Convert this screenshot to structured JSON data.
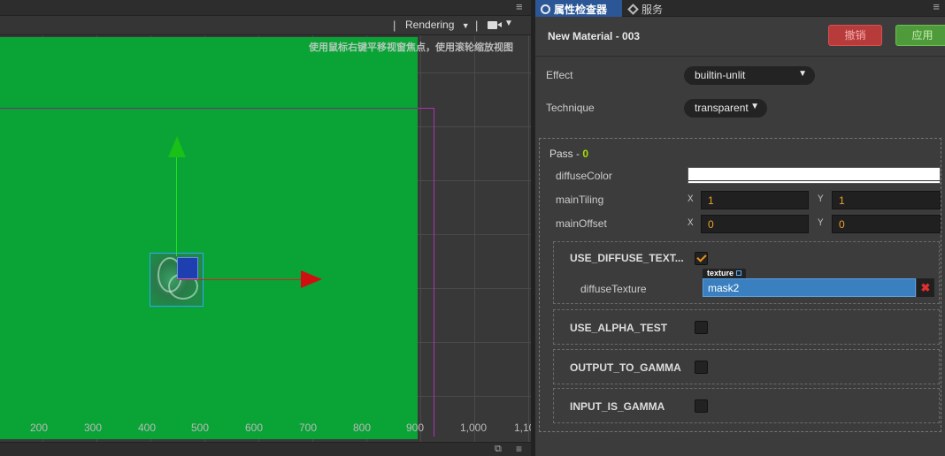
{
  "scene": {
    "rendering_label": "Rendering",
    "rendering_caret": "▼",
    "camera_caret": "▼",
    "separator": "|",
    "menu_glyph": "≡",
    "hint": "使用鼠标右键平移视窗焦点，使用滚轮缩放视图",
    "ruler": [
      "200",
      "300",
      "400",
      "500",
      "600",
      "700",
      "800",
      "900",
      "1,000",
      "1,10"
    ],
    "bottom_icon1": "⧉",
    "bottom_icon2": "≡",
    "colors": {
      "canvas": "#0aa336",
      "axis_x": "#dd2020",
      "axis_y": "#22e022",
      "selection": "#30a8ff"
    }
  },
  "inspector": {
    "tabs": [
      {
        "label": "属性检查器",
        "icon": "gear-icon"
      },
      {
        "label": "服务",
        "icon": "services-icon"
      }
    ],
    "menu_glyph": "≡",
    "material_name": "New Material - 003",
    "revert_label": "撤销",
    "apply_label": "应用",
    "effect": {
      "label": "Effect",
      "value": "builtin-unlit"
    },
    "technique": {
      "label": "Technique",
      "value": "transparent"
    },
    "caret": "▼",
    "pass": {
      "title_prefix": "Pass - ",
      "index": "0",
      "diffuse_color": {
        "label": "diffuseColor",
        "value": "#ffffff"
      },
      "main_tiling": {
        "label": "mainTiling",
        "x_label": "X",
        "x": "1",
        "y_label": "Y",
        "y": "1"
      },
      "main_offset": {
        "label": "mainOffset",
        "x_label": "X",
        "x": "0",
        "y_label": "Y",
        "y": "0"
      },
      "defines": [
        {
          "label": "USE_DIFFUSE_TEXT...",
          "checked": true
        },
        {
          "label": "USE_ALPHA_TEST",
          "checked": false
        },
        {
          "label": "OUTPUT_TO_GAMMA",
          "checked": false
        },
        {
          "label": "INPUT_IS_GAMMA",
          "checked": false
        }
      ],
      "diffuse_texture": {
        "label": "diffuseTexture",
        "tag": "texture",
        "value": "mask2",
        "clear": "✖"
      }
    }
  }
}
